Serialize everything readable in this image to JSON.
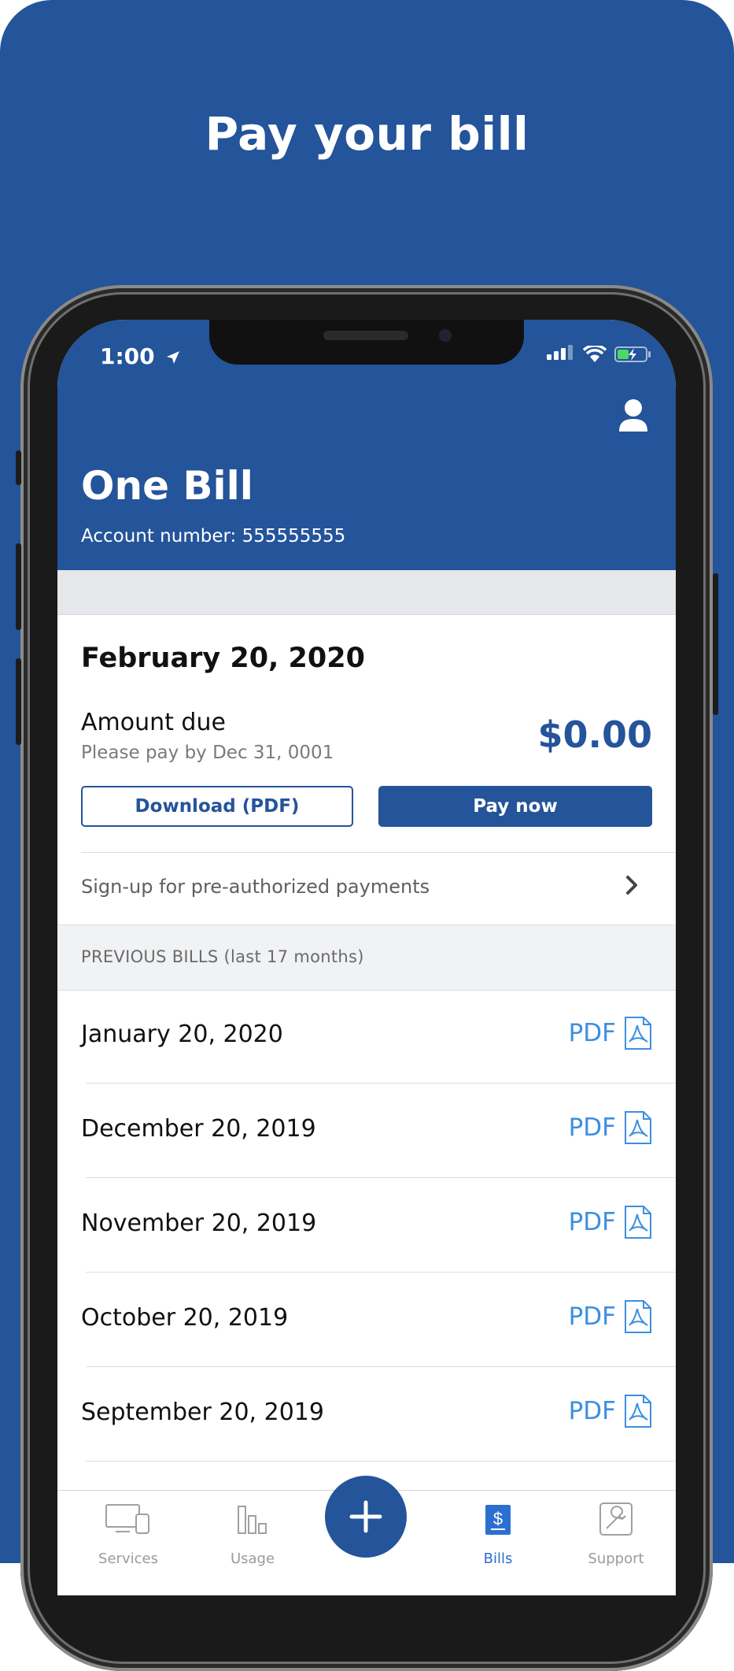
{
  "promo": {
    "headline": "Pay your bill"
  },
  "status_bar": {
    "time": "1:00"
  },
  "header": {
    "title": "One Bill",
    "account": "Account number: 555555555"
  },
  "current_bill": {
    "date": "February 20, 2020",
    "amount_label": "Amount due",
    "due_by": "Please pay by Dec 31, 0001",
    "amount": "$0.00",
    "download_label": "Download (PDF)",
    "pay_label": "Pay now"
  },
  "preauth": {
    "label": "Sign-up for pre-authorized payments"
  },
  "previous": {
    "heading": "PREVIOUS BILLS (last 17 months)",
    "pdf_label": "PDF",
    "bills": [
      {
        "date": "January 20, 2020"
      },
      {
        "date": "December 20, 2019"
      },
      {
        "date": "November 20, 2019"
      },
      {
        "date": "October 20, 2019"
      },
      {
        "date": "September 20, 2019"
      }
    ]
  },
  "tabbar": {
    "tabs": [
      {
        "label": "Services",
        "icon": "devices-icon"
      },
      {
        "label": "Usage",
        "icon": "bar-chart-icon"
      },
      {
        "label": "Bills",
        "icon": "dollar-document-icon"
      },
      {
        "label": "Support",
        "icon": "wrench-icon"
      }
    ],
    "active": "Bills",
    "fab_icon": "plus-icon"
  },
  "colors": {
    "brand": "#24549a",
    "link": "#3d8fe0",
    "active_tab": "#2c6fd1"
  }
}
